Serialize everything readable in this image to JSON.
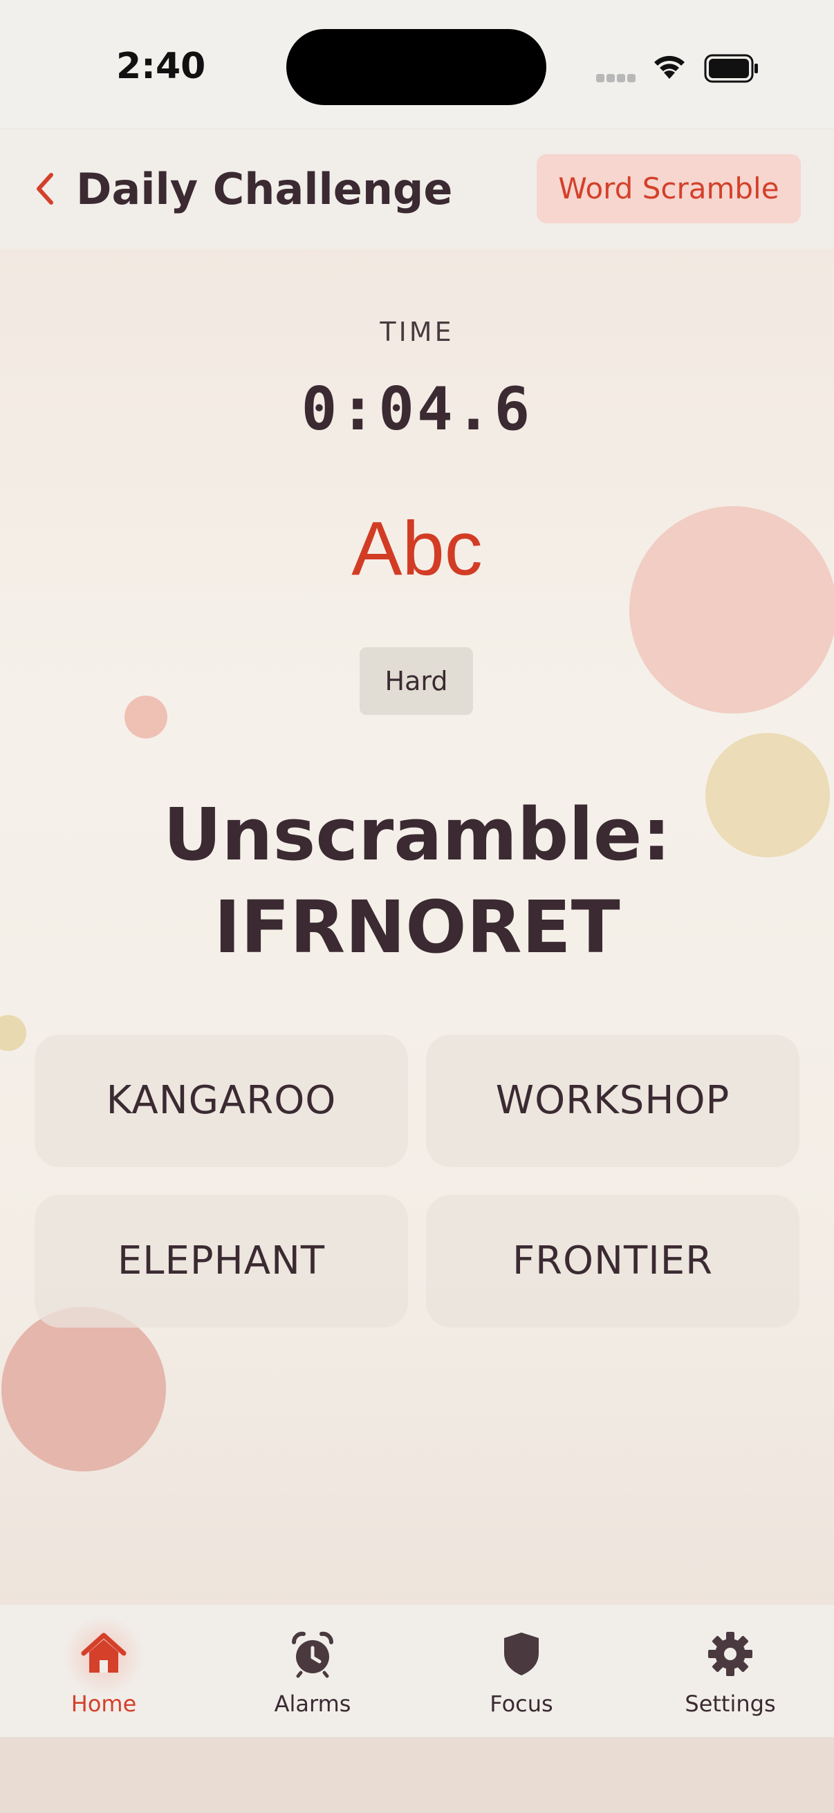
{
  "status_bar": {
    "time": "2:40"
  },
  "header": {
    "title": "Daily Challenge",
    "mode_chip": "Word Scramble"
  },
  "timer": {
    "label": "TIME",
    "value": "0:04.6"
  },
  "logo_text": "Abc",
  "difficulty": "Hard",
  "prompt": {
    "line1": "Unscramble:",
    "line2": "IFRNORET"
  },
  "options": [
    "KANGAROO",
    "WORKSHOP",
    "ELEPHANT",
    "FRONTIER"
  ],
  "tab_bar": {
    "active": "Home",
    "tabs": [
      {
        "label": "Home",
        "icon": "house-icon"
      },
      {
        "label": "Alarms",
        "icon": "alarm-clock-icon"
      },
      {
        "label": "Focus",
        "icon": "shield-icon"
      },
      {
        "label": "Settings",
        "icon": "gear-icon"
      }
    ]
  },
  "colors": {
    "accent": "#d4402a",
    "text": "#3b2a32",
    "chip_bg": "#f6d6cf",
    "option_bg": "#e9e3db"
  }
}
